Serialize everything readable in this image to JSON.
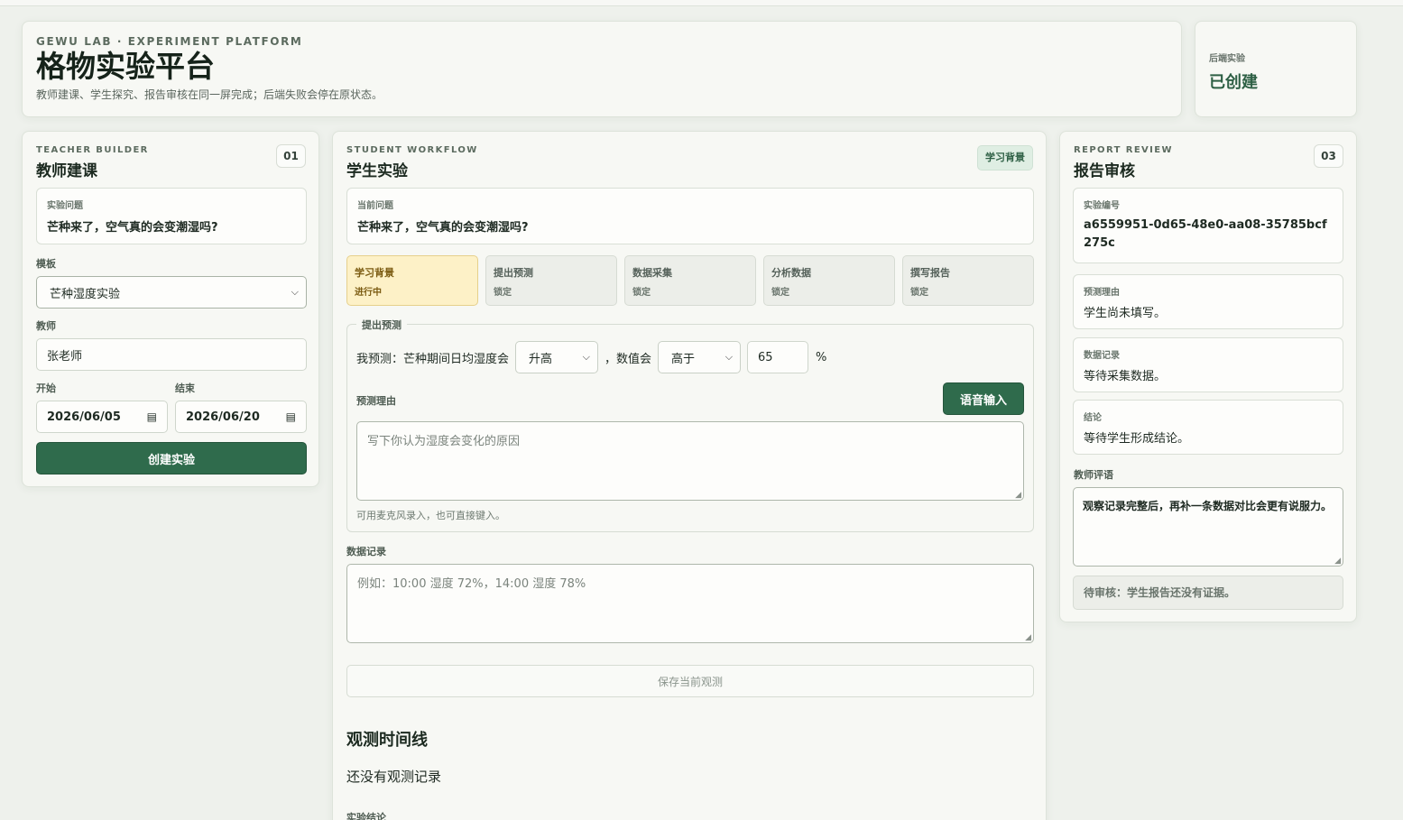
{
  "header": {
    "kicker": "GEWU LAB · EXPERIMENT PLATFORM",
    "title": "格物实验平台",
    "subtitle": "教师建课、学生探究、报告审核在同一屏完成；后端失败会停在原状态。"
  },
  "status_card": {
    "label": "后端实验",
    "value": "已创建"
  },
  "teacher": {
    "kicker": "TEACHER BUILDER",
    "title": "教师建课",
    "number": "01",
    "question_caption": "实验问题",
    "question_value": "芒种来了，空气真的会变潮湿吗?",
    "template_label": "模板",
    "template_value": "芒种湿度实验",
    "teacher_label": "教师",
    "teacher_value": "张老师",
    "start_label": "开始",
    "start_value": "2026/06/05",
    "end_label": "结束",
    "end_value": "2026/06/20",
    "create_button": "创建实验"
  },
  "student": {
    "kicker": "STUDENT WORKFLOW",
    "title": "学生实验",
    "stage_badge": "学习背景",
    "question_caption": "当前问题",
    "question_value": "芒种来了，空气真的会变潮湿吗?",
    "steps": [
      {
        "name": "学习背景",
        "state": "进行中"
      },
      {
        "name": "提出预测",
        "state": "锁定"
      },
      {
        "name": "数据采集",
        "state": "锁定"
      },
      {
        "name": "分析数据",
        "state": "锁定"
      },
      {
        "name": "撰写报告",
        "state": "锁定"
      }
    ],
    "predict": {
      "legend": "提出预测",
      "prefix": "我预测：芒种期间日均湿度会",
      "direction_value": "升高",
      "comma": "，数值会",
      "compare_value": "高于",
      "number_value": "65",
      "unit": "%",
      "reason_label": "预测理由",
      "voice_button": "语音输入",
      "reason_placeholder": "写下你认为湿度会变化的原因",
      "hint": "可用麦克风录入，也可直接键入。"
    },
    "data_label": "数据记录",
    "data_placeholder": "例如：10:00 湿度 72%，14:00 湿度 78%",
    "save_button": "保存当前观测",
    "timeline_title": "观测时间线",
    "timeline_empty": "还没有观测记录",
    "conclusion_label": "实验结论"
  },
  "review": {
    "kicker": "REPORT REVIEW",
    "title": "报告审核",
    "number": "03",
    "id_caption": "实验编号",
    "id_value": "a6559951-0d65-48e0-aa08-35785bcf275c",
    "reason_caption": "预测理由",
    "reason_value": "学生尚未填写。",
    "data_caption": "数据记录",
    "data_value": "等待采集数据。",
    "conclusion_caption": "结论",
    "conclusion_value": "等待学生形成结论。",
    "comment_label": "教师评语",
    "comment_value": "观察记录完整后，再补一条数据对比会更有说服力。",
    "pending_text": "待审核：学生报告还没有证据。"
  }
}
